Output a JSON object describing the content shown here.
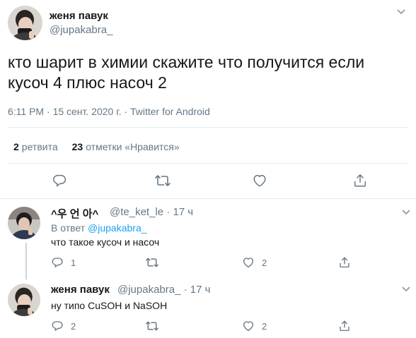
{
  "main_tweet": {
    "author_name": "женя павук",
    "author_handle": "@jupakabra_",
    "text_line1": "кто шарит в химии скажите что получится если",
    "text_line2": "кусоч 4 плюс насоч 2",
    "time": "6:11 PM",
    "date": "15 сент. 2020 г.",
    "source": "Twitter for Android",
    "retweets_count": "2",
    "retweets_label": "ретвита",
    "likes_count": "23",
    "likes_label": "отметки «Нравится»"
  },
  "replies": [
    {
      "author_name": "^우 언 아^",
      "author_handle": "@te_ket_le",
      "time_ago": "17 ч",
      "reply_to_prefix": "В ответ",
      "reply_to_handle": "@jupakabra_",
      "text": "что такое кусоч и насоч",
      "reply_count": "1",
      "retweet_count": "",
      "like_count": "2"
    },
    {
      "author_name": "женя павук",
      "author_handle": "@jupakabra_",
      "time_ago": "17 ч",
      "text": "ну типо CuSOH и NaSOH",
      "reply_count": "2",
      "retweet_count": "",
      "like_count": "2"
    }
  ],
  "separators": {
    "dot": "·"
  },
  "icons": [
    "reply-icon",
    "retweet-icon",
    "heart-icon",
    "share-icon",
    "chevron-down-icon"
  ],
  "colors": {
    "text": "#14171a",
    "muted": "#657786",
    "link": "#1da1f2",
    "border": "#e6ecf0"
  }
}
